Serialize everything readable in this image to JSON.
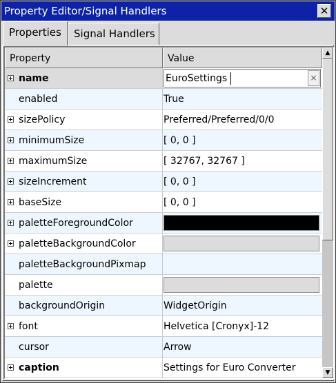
{
  "window": {
    "title": "Property Editor/Signal Handlers",
    "close_icon": "close-icon"
  },
  "tabs": [
    {
      "label": "Properties",
      "active": true
    },
    {
      "label": "Signal Handlers",
      "active": false
    }
  ],
  "table": {
    "headers": {
      "property": "Property",
      "value": "Value"
    },
    "rows": [
      {
        "name": "name",
        "value": "EuroSettings",
        "expandable": true,
        "bold": true,
        "editing": true
      },
      {
        "name": "enabled",
        "value": "True",
        "expandable": false
      },
      {
        "name": "sizePolicy",
        "value": "Preferred/Preferred/0/0",
        "expandable": true
      },
      {
        "name": "minimumSize",
        "value": "[ 0, 0 ]",
        "expandable": true
      },
      {
        "name": "maximumSize",
        "value": "[ 32767, 32767 ]",
        "expandable": true
      },
      {
        "name": "sizeIncrement",
        "value": "[ 0, 0 ]",
        "expandable": true
      },
      {
        "name": "baseSize",
        "value": "[ 0, 0 ]",
        "expandable": true
      },
      {
        "name": "paletteForegroundColor",
        "swatch": "#000000",
        "expandable": true
      },
      {
        "name": "paletteBackgroundColor",
        "swatch": "#dcdcdc",
        "expandable": true
      },
      {
        "name": "paletteBackgroundPixmap",
        "value": "",
        "expandable": false
      },
      {
        "name": "palette",
        "swatch": "#dcdcdc",
        "expandable": false
      },
      {
        "name": "backgroundOrigin",
        "value": "WidgetOrigin",
        "expandable": false
      },
      {
        "name": "font",
        "value": "Helvetica [Cronyx]-12",
        "expandable": true
      },
      {
        "name": "cursor",
        "value": "Arrow",
        "expandable": false
      },
      {
        "name": "caption",
        "value": "Settings for Euro Converter",
        "expandable": true,
        "bold": true
      }
    ]
  },
  "colors": {
    "titlebar": "#0e22a8",
    "row_alt": "#eef6ff",
    "background": "#dcdcdc"
  }
}
